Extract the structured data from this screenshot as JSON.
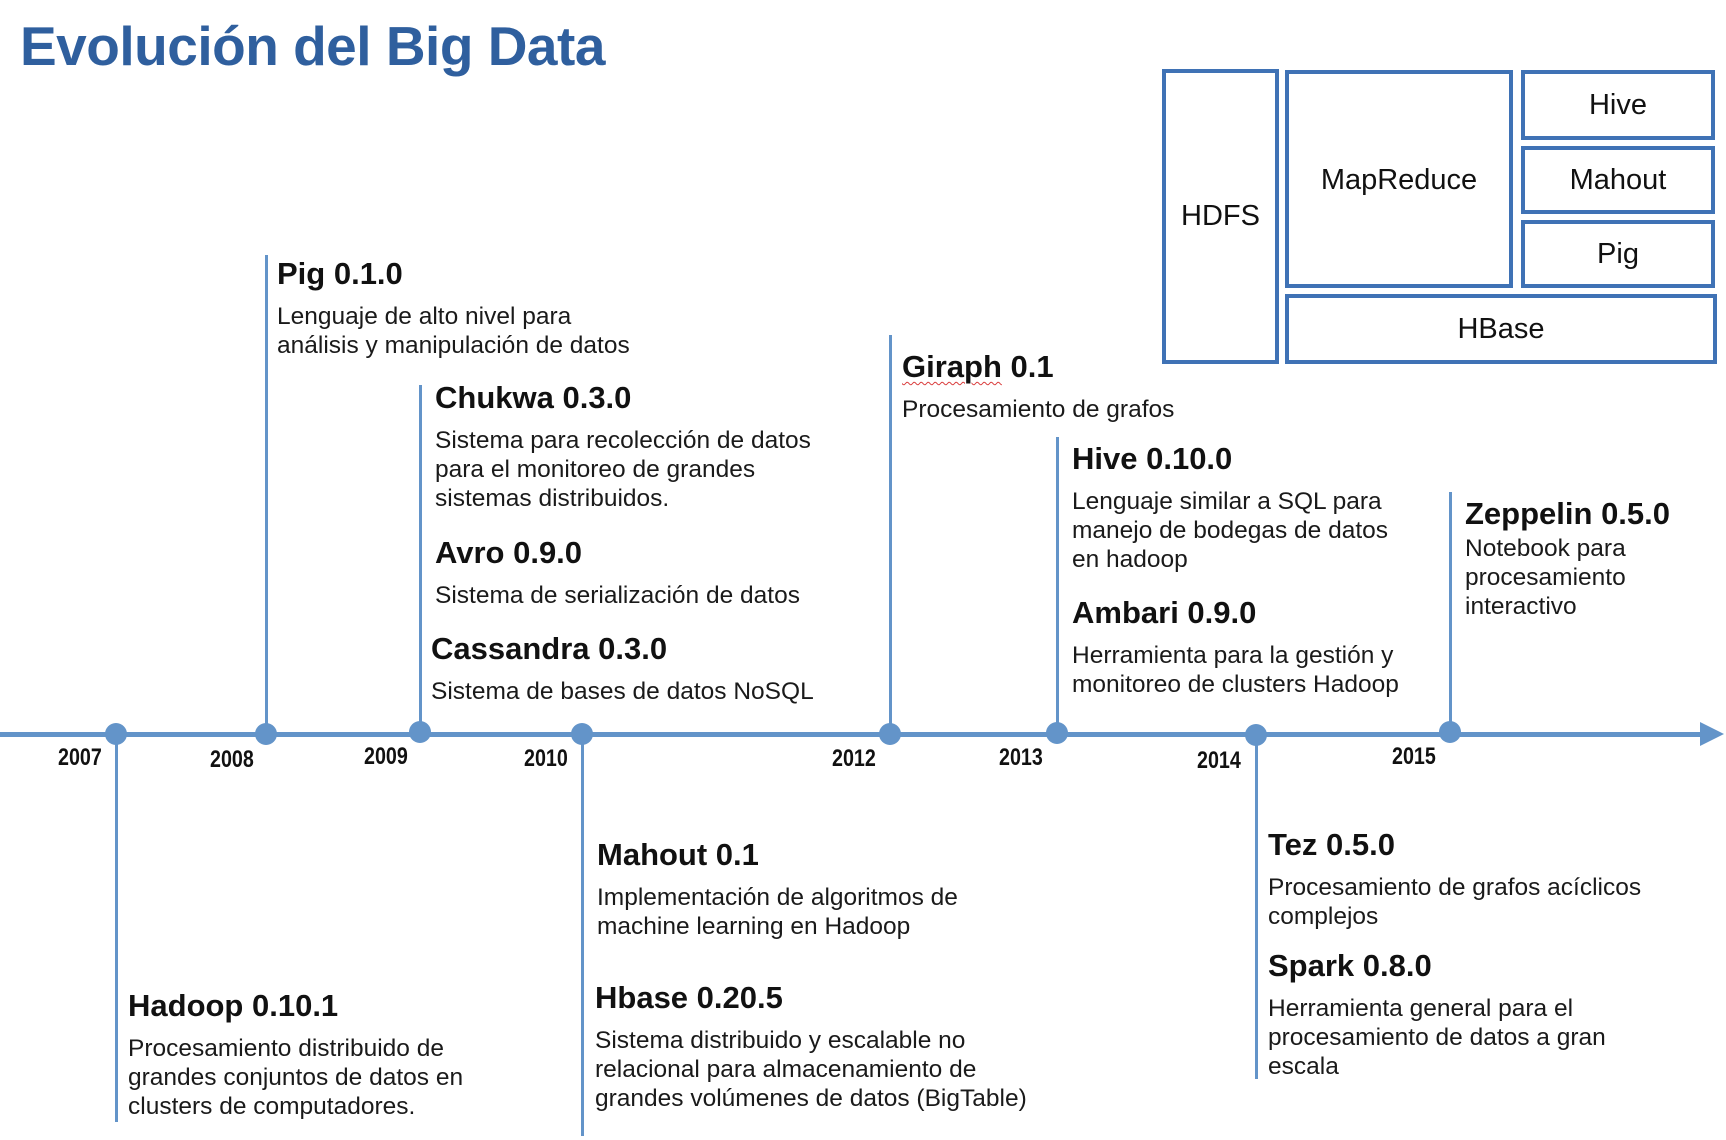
{
  "title": "Evolución del Big Data",
  "stack": {
    "hdfs": "HDFS",
    "mapreduce": "MapReduce",
    "hive": "Hive",
    "mahout": "Mahout",
    "pig": "Pig",
    "hbase": "HBase"
  },
  "years": [
    "2007",
    "2008",
    "2009",
    "2010",
    "2012",
    "2013",
    "2014",
    "2015"
  ],
  "events": {
    "pig": {
      "name": "Pig 0.1.0",
      "desc": "Lenguaje de alto nivel para\nanálisis y manipulación de datos"
    },
    "chukwa": {
      "name": "Chukwa 0.3.0",
      "desc": "Sistema para recolección de datos\npara el monitoreo de grandes\nsistemas distribuidos."
    },
    "avro": {
      "name": "Avro 0.9.0",
      "desc": "Sistema de serialización de datos"
    },
    "cassandra": {
      "name": "Cassandra 0.3.0",
      "desc": "Sistema de bases de datos NoSQL"
    },
    "giraph": {
      "name_word": "Giraph",
      "name_version": " 0.1",
      "desc": "Procesamiento de grafos"
    },
    "hive": {
      "name": "Hive 0.10.0",
      "desc": "Lenguaje similar a SQL para\nmanejo de bodegas de datos\nen hadoop"
    },
    "ambari": {
      "name": "Ambari 0.9.0",
      "desc": "Herramienta para la gestión y\nmonitoreo de clusters Hadoop"
    },
    "zeppelin": {
      "name": "Zeppelin 0.5.0",
      "desc": "Notebook para\nprocesamiento\ninteractivo"
    },
    "hadoop": {
      "name": "Hadoop 0.10.1",
      "desc": "Procesamiento distribuido de\ngrandes conjuntos de datos en\nclusters de computadores."
    },
    "mahout": {
      "name": "Mahout  0.1",
      "desc": "Implementación de algoritmos de\nmachine learning en Hadoop"
    },
    "hbase": {
      "name": "Hbase 0.20.5",
      "desc": "Sistema distribuido y escalable no\nrelacional para almacenamiento de\ngrandes volúmenes de datos (BigTable)"
    },
    "tez": {
      "name": "Tez 0.5.0",
      "desc": "Procesamiento de grafos acíclicos\ncomplejos"
    },
    "spark": {
      "name": "Spark 0.8.0",
      "desc": "Herramienta general para el\nprocesamiento de datos a gran\nescala"
    }
  },
  "colors": {
    "title": "#2f5f9e",
    "stack_border": "#3f72b5",
    "timeline": "#6394c9"
  }
}
